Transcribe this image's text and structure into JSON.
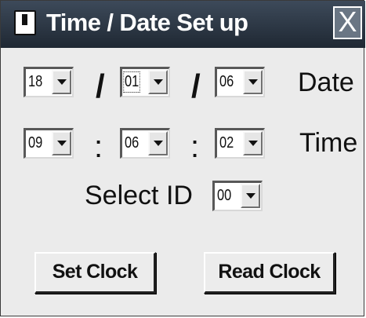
{
  "window": {
    "title": "Time / Date Set up",
    "close_label": "X"
  },
  "date": {
    "day": "18",
    "month": "01",
    "year": "06",
    "separator": "/",
    "label": "Date"
  },
  "time": {
    "hour": "09",
    "minute": "06",
    "second": "02",
    "separator": ":",
    "label": "Time"
  },
  "select_id": {
    "label": "Select ID",
    "value": "00"
  },
  "buttons": {
    "set_clock": "Set Clock",
    "read_clock": "Read Clock"
  },
  "icons": {
    "app": "app-icon",
    "close": "close-icon",
    "dropdown": "chevron-down-icon"
  }
}
